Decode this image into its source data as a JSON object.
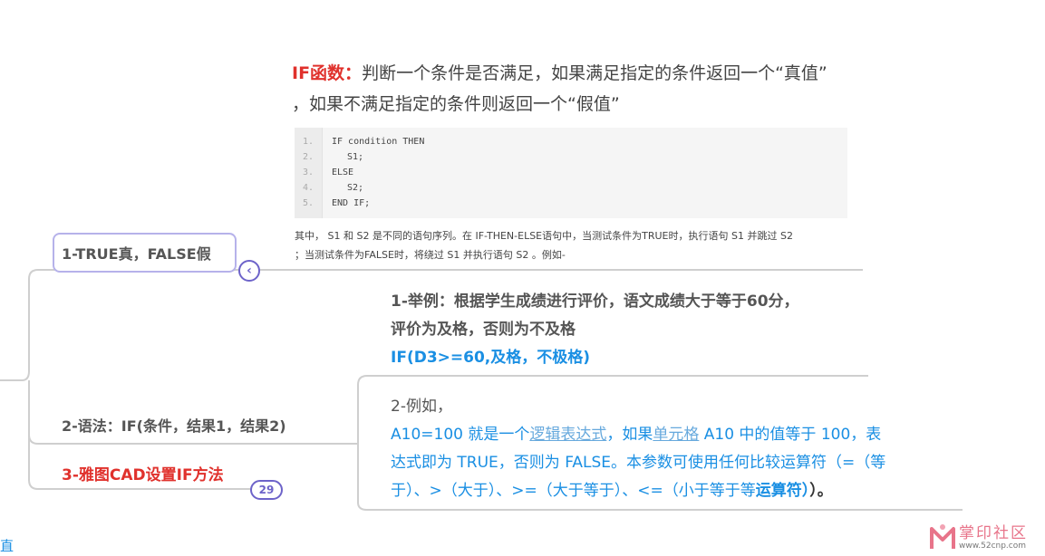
{
  "if_desc": {
    "keyword": "IF函数：",
    "line1": "判断一个条件是否满足，如果满足指定的条件返回一个“真值”",
    "line2": "，如果不满足指定的条件则返回一个“假值”"
  },
  "code": {
    "line_numbers": [
      "1.",
      "2.",
      "3.",
      "4.",
      "5."
    ],
    "lines": [
      "IF condition THEN",
      "S1;",
      "ELSE",
      "S2;",
      "END IF;"
    ]
  },
  "code_note": {
    "line1": "其中， S1 和 S2 是不同的语句序列。在 IF-THEN-ELSE语句中，当测试条件为TRUE时，执行语句 S1 并跳过 S2",
    "line2": "；当测试条件为FALSE时，将绕过 S1 并执行语句 S2 。例如-"
  },
  "mindmap": {
    "node1": {
      "label": "1-TRUE真，FALSE假",
      "collapse_glyph": "‹"
    },
    "node2": {
      "label": "2-语法：IF(条件，结果1，结果2)"
    },
    "node3": {
      "label": "3-雅图CAD设置IF方法",
      "badge": "29"
    },
    "example1": {
      "line1": "1-举例：根据学生成绩进行评价，语文成绩大于等于60分，",
      "line2": "评价为及格，否则为不及格",
      "line3": "IF(D3>=60,及格，不极格)"
    },
    "example2": {
      "line1": "2-例如，",
      "line2_a": "A10=100 就是一个",
      "line2_link1": "逻辑表达式",
      "line2_b": "，如果",
      "line2_link2": "单元格",
      "line2_c": " A10 中的值等于 100，表",
      "line3": "达式即为 TRUE，否则为 FALSE。本参数可使用任何比较运算符（=（等",
      "line4_a": "于）、>（大于）、>=（大于等于）、<=（小于等于等",
      "line4_b": "运算符）",
      "line4_c": "）。"
    }
  },
  "watermark": {
    "title": "掌印社区",
    "url": "www.52cnp.com"
  },
  "edge_char": "直",
  "colors": {
    "accent_red": "#e0312c",
    "accent_blue": "#1a8fe3",
    "node_border": "#b6b2ea",
    "button_purple": "#6d63c9"
  }
}
